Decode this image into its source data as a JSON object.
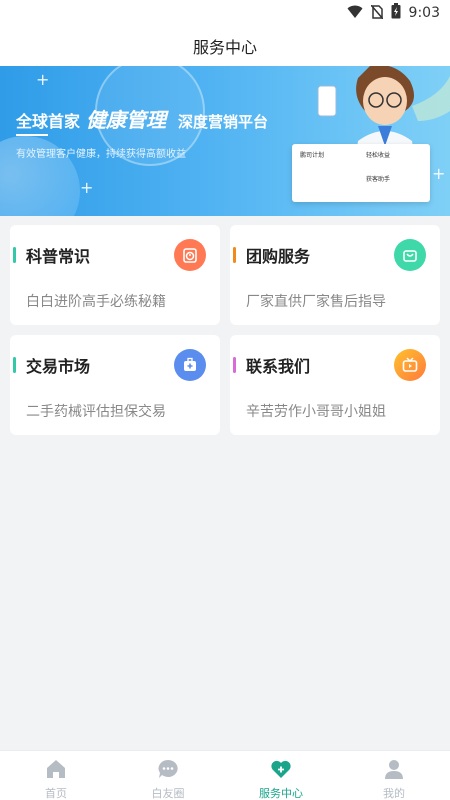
{
  "status_bar": {
    "time": "9:03",
    "icons": [
      "wifi-icon",
      "no-sim-icon",
      "battery-charging-icon"
    ]
  },
  "header": {
    "title": "服务中心"
  },
  "banner": {
    "headline_part1": "全球首家",
    "headline_highlight": "健康管理",
    "headline_part2": "深度营销平台",
    "subtitle": "有效管理客户健康，持续获得高额收益",
    "mini_card_labels": [
      "鹏司计划",
      "轻松收益",
      "获客助手"
    ]
  },
  "cards": [
    {
      "title": "科普常识",
      "description": "白白进阶高手必练秘籍",
      "accent": "#33c9a8",
      "icon": "alarm-clock-icon",
      "icon_color": "#ff7a54"
    },
    {
      "title": "团购服务",
      "description": "厂家直供厂家售后指导",
      "accent": "#f08a1d",
      "icon": "shopping-bag-icon",
      "icon_color": "#3fd8a8"
    },
    {
      "title": "交易市场",
      "description": "二手药械评估担保交易",
      "accent": "#33c9a8",
      "icon": "medical-kit-icon",
      "icon_color": "#5b8def"
    },
    {
      "title": "联系我们",
      "description": "辛苦劳作小哥哥小姐姐",
      "accent": "#d96ad8",
      "icon": "tv-play-icon",
      "icon_color": "#ff8a3c"
    }
  ],
  "tabs": [
    {
      "label": "首页",
      "icon": "home-icon",
      "active": false
    },
    {
      "label": "白友圈",
      "icon": "chat-bubble-icon",
      "active": false
    },
    {
      "label": "服务中心",
      "icon": "heart-plus-icon",
      "active": true
    },
    {
      "label": "我的",
      "icon": "user-icon",
      "active": false
    }
  ],
  "colors": {
    "active_tab": "#1aa58a",
    "inactive_tab": "#b5bcc4"
  }
}
